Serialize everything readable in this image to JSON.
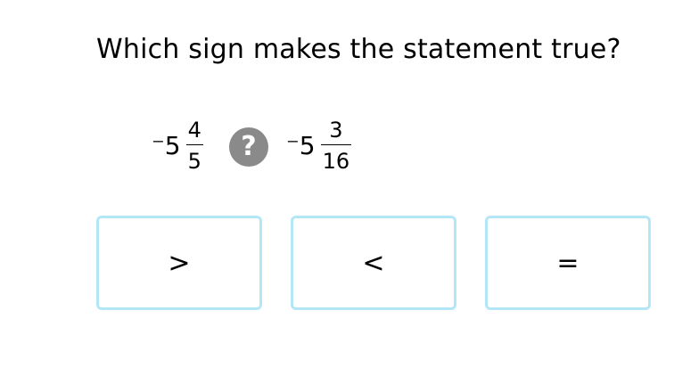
{
  "question": {
    "text": "Which sign makes the statement true?"
  },
  "expression": {
    "left": {
      "whole": "⁻5",
      "numerator": "4",
      "denominator": "5"
    },
    "operator_icon": "question-mark-icon",
    "operator_symbol": "?",
    "right": {
      "whole": "⁻5",
      "numerator": "3",
      "denominator": "16"
    }
  },
  "choices": [
    {
      "label": ">"
    },
    {
      "label": "<"
    },
    {
      "label": "="
    }
  ],
  "colors": {
    "choice_border": "#b3e7f7",
    "help_icon_bg": "#8a8a8a"
  }
}
